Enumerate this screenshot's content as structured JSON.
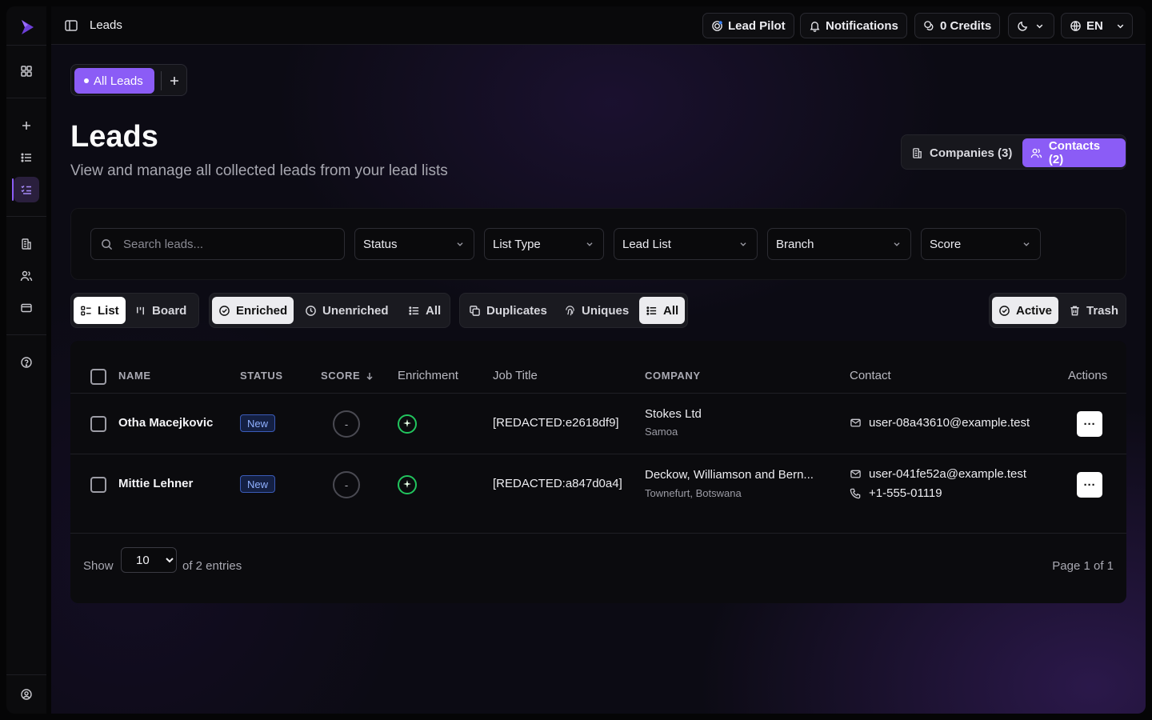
{
  "app": {
    "accent": "#8b5cf6"
  },
  "topbar": {
    "title": "Leads",
    "lead_pilot": "Lead Pilot",
    "notifications": "Notifications",
    "credits": "0 Credits",
    "language": "EN"
  },
  "lists": {
    "active_tab": "All Leads"
  },
  "header": {
    "title": "Leads",
    "subtitle": "View and manage all collected leads from your lead lists",
    "companies_tab": "Companies (3)",
    "contacts_tab": "Contacts (2)"
  },
  "filters": {
    "search_placeholder": "Search leads...",
    "status": "Status",
    "list_type": "List Type",
    "lead_list": "Lead List",
    "branch": "Branch",
    "score": "Score"
  },
  "views": {
    "list": "List",
    "board": "Board",
    "enriched": "Enriched",
    "unenriched": "Unenriched",
    "all_enrich": "All",
    "duplicates": "Duplicates",
    "uniques": "Uniques",
    "all_dup": "All",
    "active": "Active",
    "trash": "Trash"
  },
  "table": {
    "columns": {
      "name": "NAME",
      "status": "STATUS",
      "score": "SCORE",
      "enrichment": "Enrichment",
      "job_title": "Job Title",
      "company": "COMPANY",
      "contact": "Contact",
      "actions": "Actions"
    },
    "rows": [
      {
        "name": "Otha Macejkovic",
        "status": "New",
        "score": "-",
        "job_title": "[REDACTED:e2618df9]",
        "company": "Stokes Ltd",
        "location": "Samoa",
        "email": "user-08a43610@example.test",
        "phone": ""
      },
      {
        "name": "Mittie Lehner",
        "status": "New",
        "score": "-",
        "job_title": "[REDACTED:a847d0a4]",
        "company": "Deckow, Williamson and Bern...",
        "location": "Townefurt, Botswana",
        "email": "user-041fe52a@example.test",
        "phone": "+1-555-01119"
      }
    ],
    "actions_label": "···"
  },
  "footer": {
    "show": "Show",
    "page_size": "10",
    "entries": "of 2 entries",
    "page": "Page 1 of 1"
  }
}
